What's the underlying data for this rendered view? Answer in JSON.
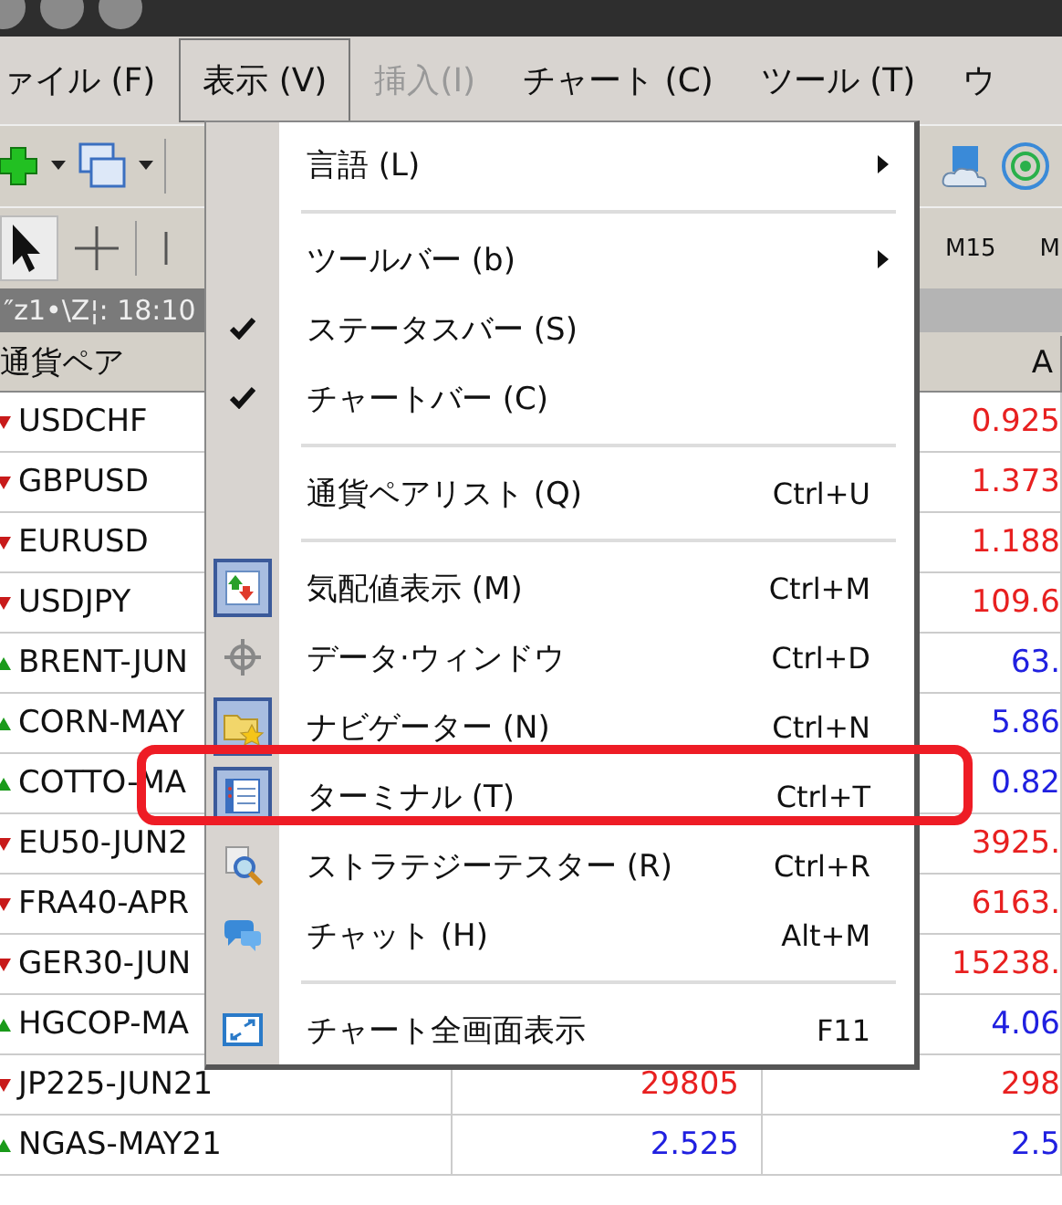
{
  "menubar": [
    {
      "label": "ァイル (F)",
      "selected": false,
      "disabled": false
    },
    {
      "label": "表示 (V)",
      "selected": true,
      "disabled": false
    },
    {
      "label": "挿入(I)",
      "selected": false,
      "disabled": true
    },
    {
      "label": "チャート (C)",
      "selected": false,
      "disabled": false
    },
    {
      "label": "ツール (T)",
      "selected": false,
      "disabled": false
    },
    {
      "label": "ウ",
      "selected": false,
      "disabled": false
    }
  ],
  "periods": [
    "M15",
    "M"
  ],
  "server_time": "″z1•\\Z¦: 18:10",
  "table": {
    "columns": [
      "通貨ペア",
      "",
      "A"
    ],
    "rows": [
      {
        "symbol": "USDCHF",
        "kind": "down",
        "ask": "0.925"
      },
      {
        "symbol": "GBPUSD",
        "kind": "down",
        "ask": "1.373"
      },
      {
        "symbol": "EURUSD",
        "kind": "down",
        "ask": "1.188"
      },
      {
        "symbol": "USDJPY",
        "kind": "down",
        "ask": "109.6"
      },
      {
        "symbol": "BRENT-JUN",
        "kind": "up",
        "ask": "63."
      },
      {
        "symbol": "CORN-MAY",
        "kind": "up",
        "ask": "5.86"
      },
      {
        "symbol": "COTTO-MA",
        "kind": "up",
        "ask": "0.82"
      },
      {
        "symbol": "EU50-JUN2",
        "kind": "down",
        "ask": "3925."
      },
      {
        "symbol": "FRA40-APR",
        "kind": "down",
        "ask": "6163."
      },
      {
        "symbol": "GER30-JUN",
        "kind": "down",
        "ask": "15238."
      },
      {
        "symbol": "HGCOP-MA",
        "kind": "up",
        "ask": "4.06"
      },
      {
        "symbol": "JP225-JUN21",
        "kind": "down",
        "bid": "29805",
        "ask": "298"
      },
      {
        "symbol": "NGAS-MAY21",
        "kind": "up",
        "bid": "2.525",
        "ask": "2.5"
      }
    ]
  },
  "menu": {
    "items": [
      {
        "kind": "item",
        "label": "言語 (L)",
        "submenu": true,
        "checked": false
      },
      {
        "kind": "separator"
      },
      {
        "kind": "item",
        "label": "ツールバー (b)",
        "submenu": true,
        "checked": false
      },
      {
        "kind": "item",
        "label": "ステータスバー (S)",
        "checked": true
      },
      {
        "kind": "item",
        "label": "チャートバー (C)",
        "checked": true
      },
      {
        "kind": "separator"
      },
      {
        "kind": "item",
        "label": "通貨ペアリスト (Q)",
        "shortcut": "Ctrl+U",
        "checked": false
      },
      {
        "kind": "separator"
      },
      {
        "kind": "item",
        "label": "気配値表示 (M)",
        "shortcut": "Ctrl+M",
        "checked": true
      },
      {
        "kind": "item",
        "label": "データ·ウィンドウ",
        "shortcut": "Ctrl+D",
        "checked": false
      },
      {
        "kind": "item",
        "label": "ナビゲーター (N)",
        "shortcut": "Ctrl+N",
        "checked": true
      },
      {
        "kind": "item",
        "label": "ターミナル (T)",
        "shortcut": "Ctrl+T",
        "checked": true,
        "highlighted": true
      },
      {
        "kind": "item",
        "label": "ストラテジーテスター (R)",
        "shortcut": "Ctrl+R",
        "checked": false
      },
      {
        "kind": "item",
        "label": "チャット (H)",
        "shortcut": "Alt+M",
        "checked": false
      },
      {
        "kind": "separator"
      },
      {
        "kind": "item",
        "label": "チャート全画面表示",
        "shortcut": "F11",
        "checked": false
      }
    ]
  }
}
